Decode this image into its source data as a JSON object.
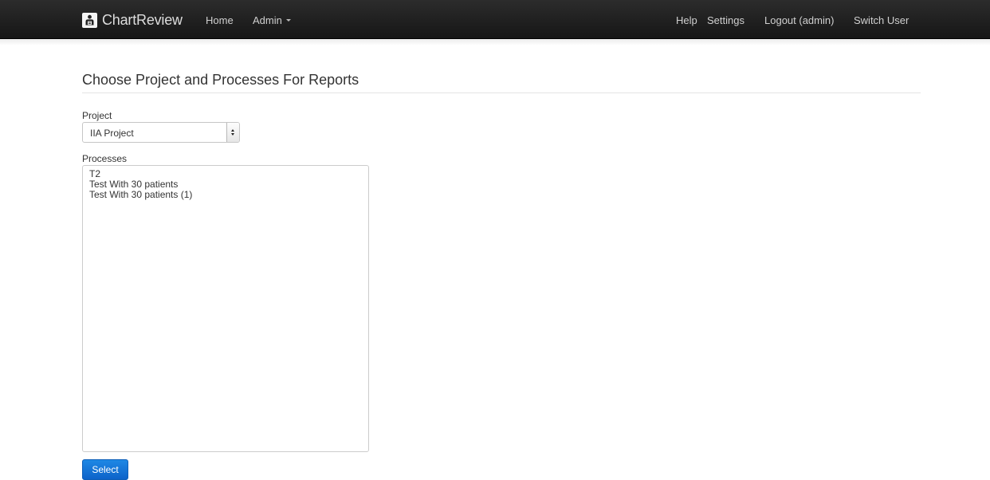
{
  "navbar": {
    "brand": "ChartReview",
    "brand_icon": "patient-chart-icon",
    "left_links": [
      "Home",
      "Admin"
    ],
    "right_links": [
      "Help",
      "Settings",
      "Logout (admin)",
      "Switch User"
    ]
  },
  "page": {
    "title": "Choose Project and Processes For Reports"
  },
  "form": {
    "project_label": "Project",
    "project_selected": "IIA Project",
    "processes_label": "Processes",
    "processes": [
      "T2",
      "Test With 30 patients",
      "Test With 30 patients (1)"
    ],
    "submit_label": "Select"
  },
  "colors": {
    "navbar_bg": "#1b1b1b",
    "primary_button": "#1677d6"
  }
}
